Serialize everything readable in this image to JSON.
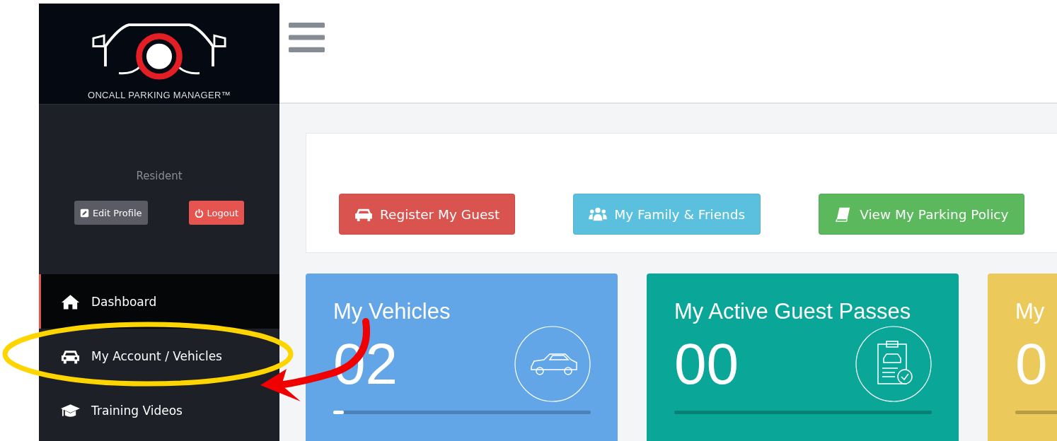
{
  "logo": {
    "title": "ONCALL PARKING MANAGER™"
  },
  "profile": {
    "role": "Resident",
    "buttons": [
      {
        "label": "Edit Profile",
        "kind": "edit"
      },
      {
        "label": "Logout",
        "kind": "logout"
      }
    ]
  },
  "sidebar": {
    "items": [
      {
        "label": "Dashboard",
        "kind": "home",
        "selected": true
      },
      {
        "label": "My Account / Vehicles",
        "kind": "car",
        "selected": false
      },
      {
        "label": "Training Videos",
        "kind": "cap",
        "selected": false
      }
    ]
  },
  "actions": [
    {
      "label": "Register My Guest",
      "kind": "car",
      "color": "#d9534f"
    },
    {
      "label": "My Family & Friends",
      "kind": "users",
      "color": "#5bc0de"
    },
    {
      "label": "View My Parking Policy",
      "kind": "book",
      "color": "#5cb85c"
    }
  ],
  "cards": [
    {
      "title": "My Vehicles",
      "value": "02",
      "kind": "car",
      "color": "#62a6e8",
      "level": 0.04
    },
    {
      "title": "My Active Guest Passes",
      "value": "00",
      "kind": "clipboard",
      "color": "#0aa698"
    },
    {
      "title": "My",
      "value": "0",
      "kind": "other",
      "color": "#ebc95a"
    }
  ]
}
